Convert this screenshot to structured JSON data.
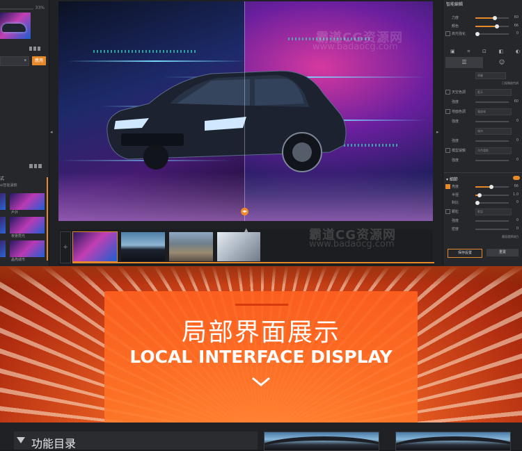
{
  "left_panel": {
    "percent": "33%",
    "apply_button": "應用",
    "section_title": "式",
    "section_sub": "ai智能濾鏡",
    "presets": [
      {
        "label": "戶外"
      },
      {
        "label": "夜景霓光"
      },
      {
        "label": "晶亮城市"
      }
    ],
    "collapse_arrow": "◂"
  },
  "viewer": {
    "compare_handle": "◂▸",
    "watermark_cn": "霸道CG资源网",
    "watermark_url": "www.badaocg.com"
  },
  "filmstrip": {
    "add_label": "+",
    "up_arrow": "▲"
  },
  "right_panel": {
    "title": "智能編輯",
    "sliders_top": [
      {
        "label": "力度",
        "value": "60",
        "fill": 0.55
      },
      {
        "label": "顏色",
        "value": "66",
        "fill": 0.62
      },
      {
        "label": "高光強化",
        "value": "0",
        "fill": 0.0
      }
    ],
    "tabs": [
      "adjust-icon",
      "face-icon"
    ],
    "select_top": "原圖",
    "link_text": "已經開啟色調",
    "rows": [
      {
        "label": "天空色調",
        "dropdown": "藍天"
      },
      {
        "label": "強度",
        "value": "60"
      },
      {
        "label": "地面色調",
        "dropdown": "霧面綠"
      },
      {
        "label": "強度",
        "value": "0"
      },
      {
        "label": "",
        "dropdown": "城市"
      },
      {
        "label": "強度",
        "value": "0"
      },
      {
        "label": "模型濾鏡",
        "dropdown": "冷色電影"
      },
      {
        "label": "強度",
        "value": "0"
      }
    ],
    "detail": {
      "title": "細節",
      "items": [
        {
          "label": "亮度",
          "value": "66",
          "fill": 0.45
        },
        {
          "label": "半徑",
          "value": "1.0",
          "fill": 0.1
        },
        {
          "label": "對比",
          "value": "0",
          "fill": 0.0
        }
      ],
      "dropdown_label": "顆粒",
      "dropdown_value": "默認",
      "extra": [
        {
          "label": "強度",
          "value": "0"
        },
        {
          "label": "密度",
          "value": "0"
        }
      ],
      "hint": "畫面選擇項目"
    },
    "btn_save": "保存設置",
    "btn_reset": "重置"
  },
  "banner": {
    "title_cn": "局部界面展示",
    "title_en": "LOCAL INTERFACE DISPLAY"
  },
  "bottom": {
    "menu_label": "功能目录"
  },
  "colors": {
    "accent": "#e6892a",
    "panel": "#26272b",
    "banner_orange": "#ff6a26"
  }
}
